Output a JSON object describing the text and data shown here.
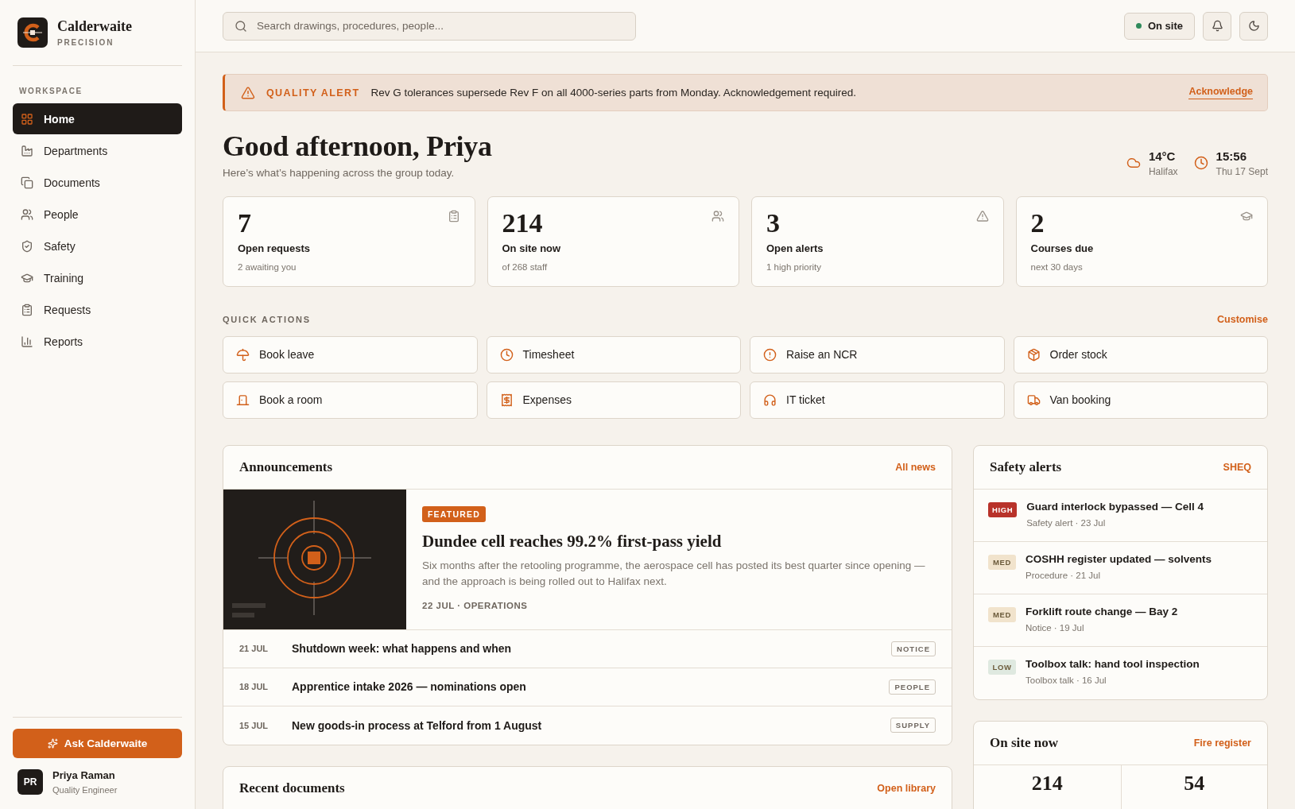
{
  "brand": {
    "name": "Calderwaite",
    "tagline": "PRECISION"
  },
  "sidebar": {
    "section": "WORKSPACE",
    "items": [
      {
        "label": "Home",
        "selected": true
      },
      {
        "label": "Departments",
        "selected": false
      },
      {
        "label": "Documents",
        "selected": false
      },
      {
        "label": "People",
        "selected": false
      },
      {
        "label": "Safety",
        "selected": false
      },
      {
        "label": "Training",
        "selected": false
      },
      {
        "label": "Requests",
        "selected": false
      },
      {
        "label": "Reports",
        "selected": false
      }
    ],
    "assistant_button": "Ask Calderwaite",
    "user": {
      "initials": "PR",
      "name": "Priya Raman",
      "role": "Quality Engineer"
    }
  },
  "topbar": {
    "search": {
      "placeholder": "Search drawings, procedures, people..."
    },
    "status": "On site"
  },
  "alert": {
    "title": "QUALITY ALERT",
    "message": "Rev G tolerances supersede Rev F on all 4000-series parts from Monday. Acknowledgement required.",
    "action": "Acknowledge"
  },
  "greeting": {
    "title": "Good afternoon, Priya",
    "subtitle": "Here’s what’s happening across the group today."
  },
  "weather": {
    "temperature": "14°C",
    "place": "Halifax"
  },
  "clock": {
    "time": "15:56",
    "date": "Thu 17 Sept"
  },
  "stats": [
    {
      "value": "7",
      "label": "Open requests",
      "note": "2 awaiting you"
    },
    {
      "value": "214",
      "label": "On site now",
      "note": "of 268 staff"
    },
    {
      "value": "3",
      "label": "Open alerts",
      "note": "1 high priority"
    },
    {
      "value": "2",
      "label": "Courses due",
      "note": "next 30 days"
    }
  ],
  "quick_actions": {
    "title": "QUICK ACTIONS",
    "link": "Customise",
    "items": [
      "Book leave",
      "Timesheet",
      "Raise an NCR",
      "Order stock",
      "Book a room",
      "Expenses",
      "IT ticket",
      "Van booking"
    ]
  },
  "announcements": {
    "title": "Announcements",
    "link": "All news",
    "featured": {
      "badge": "FEATURED",
      "headline": "Dundee cell reaches 99.2% first-pass yield",
      "summary": "Six months after the retooling programme, the aerospace cell has posted its best quarter since opening — and the approach is being rolled out to Halifax next.",
      "meta": "22 JUL · OPERATIONS"
    },
    "items": [
      {
        "date": "21 JUL",
        "title": "Shutdown week: what happens and when",
        "tag": "NOTICE"
      },
      {
        "date": "18 JUL",
        "title": "Apprentice intake 2026 — nominations open",
        "tag": "PEOPLE"
      },
      {
        "date": "15 JUL",
        "title": "New goods-in process at Telford from 1 August",
        "tag": "SUPPLY"
      }
    ]
  },
  "recent_documents": {
    "title": "Recent documents",
    "link": "Open library"
  },
  "safety_alerts": {
    "title": "Safety alerts",
    "link": "SHEQ",
    "items": [
      {
        "color": "#b8322a",
        "badge": "HIGH",
        "title": "Guard interlock bypassed — Cell 4",
        "meta": "Safety alert · 23 Jul"
      },
      {
        "color": "#f1e3cc",
        "badge": "MED",
        "title": "COSHH register updated — solvents",
        "meta": "Procedure · 21 Jul"
      },
      {
        "color": "#f1e3cc",
        "badge": "MED",
        "title": "Forklift route change — Bay 2",
        "meta": "Notice · 19 Jul"
      },
      {
        "color": "#dfe9e0",
        "badge": "LOW",
        "title": "Toolbox talk: hand tool inspection",
        "meta": "Toolbox talk · 16 Jul"
      }
    ]
  },
  "on_site": {
    "title": "On site now",
    "link": "Fire register",
    "counts": [
      "214",
      "54"
    ]
  }
}
